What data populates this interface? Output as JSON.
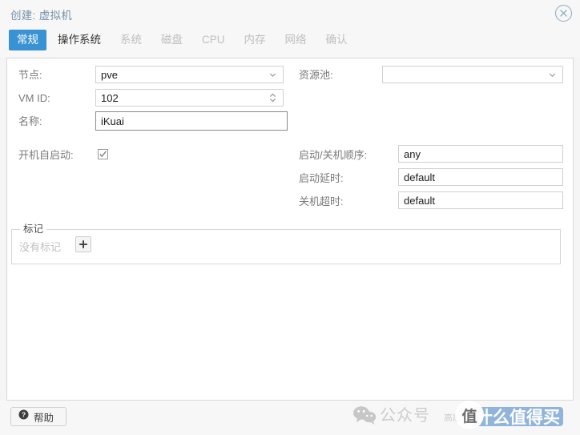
{
  "window": {
    "title": "创建: 虚拟机",
    "close_icon": "close-circle-icon"
  },
  "tabs": [
    {
      "label": "常规",
      "state": "active"
    },
    {
      "label": "操作系统",
      "state": "enabled"
    },
    {
      "label": "系统",
      "state": "disabled"
    },
    {
      "label": "磁盘",
      "state": "disabled"
    },
    {
      "label": "CPU",
      "state": "disabled"
    },
    {
      "label": "内存",
      "state": "disabled"
    },
    {
      "label": "网络",
      "state": "disabled"
    },
    {
      "label": "确认",
      "state": "disabled"
    }
  ],
  "form": {
    "node": {
      "label": "节点:",
      "value": "pve",
      "control": "combobox"
    },
    "vmid": {
      "label": "VM ID:",
      "value": "102",
      "control": "spinner"
    },
    "name": {
      "label": "名称:",
      "value": "iKuai",
      "control": "text",
      "focused": true
    },
    "pool": {
      "label": "资源池:",
      "value": "",
      "control": "combobox"
    },
    "autostart": {
      "label": "开机自启动:",
      "checked": true,
      "control": "checkbox"
    },
    "start_order": {
      "label": "启动/关机顺序:",
      "value": "any",
      "control": "text"
    },
    "startup_delay": {
      "label": "启动延时:",
      "value": "default",
      "control": "text"
    },
    "shutdown_timeout": {
      "label": "关机超时:",
      "value": "default",
      "control": "text"
    }
  },
  "tags": {
    "legend": "标记",
    "empty_text": "没有标记",
    "add_label": "+"
  },
  "footer": {
    "help_label": "帮助",
    "help_icon": "question-circle-icon"
  },
  "watermark": {
    "wechat_icon": "wechat-icon",
    "gzh_text": "公众号",
    "small_text": "高能",
    "circle_text": "值",
    "badge_text": "什么值得买"
  },
  "colors": {
    "accent": "#3892d4",
    "title": "#7592a8",
    "label": "#7a7a7a",
    "panel_border": "#d8d8d8",
    "chrome": "#f7f7f7"
  }
}
